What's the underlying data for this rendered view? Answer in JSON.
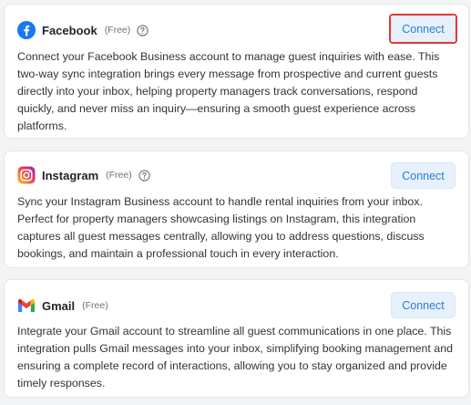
{
  "integrations": [
    {
      "name": "Facebook",
      "tier": "(Free)",
      "icon": "facebook-icon",
      "button_label": "Connect",
      "highlighted": true,
      "description": "Connect your Facebook Business account to manage guest inquiries with ease. This two-way sync integration brings every message from prospective and current guests directly into your inbox, helping property managers track conversations, respond quickly, and never miss an inquiry—ensuring a smooth guest experience across platforms."
    },
    {
      "name": "Instagram",
      "tier": "(Free)",
      "icon": "instagram-icon",
      "button_label": "Connect",
      "highlighted": false,
      "description": "Sync your Instagram Business account to handle rental inquiries from your inbox. Perfect for property managers showcasing listings on Instagram, this integration captures all guest messages centrally, allowing you to address questions, discuss bookings, and maintain a professional touch in every interaction."
    },
    {
      "name": "Gmail",
      "tier": "(Free)",
      "icon": "gmail-icon",
      "button_label": "Connect",
      "highlighted": false,
      "description": "Integrate your Gmail account to streamline all guest communications in one place. This integration pulls Gmail messages into your inbox, simplifying booking management and ensuring a complete record of interactions, allowing you to stay organized and provide timely responses."
    }
  ],
  "colors": {
    "button_bg": "#e6f1fb",
    "button_text": "#2b7cd3",
    "highlight_border": "#e53935",
    "facebook_blue": "#1877f2"
  }
}
